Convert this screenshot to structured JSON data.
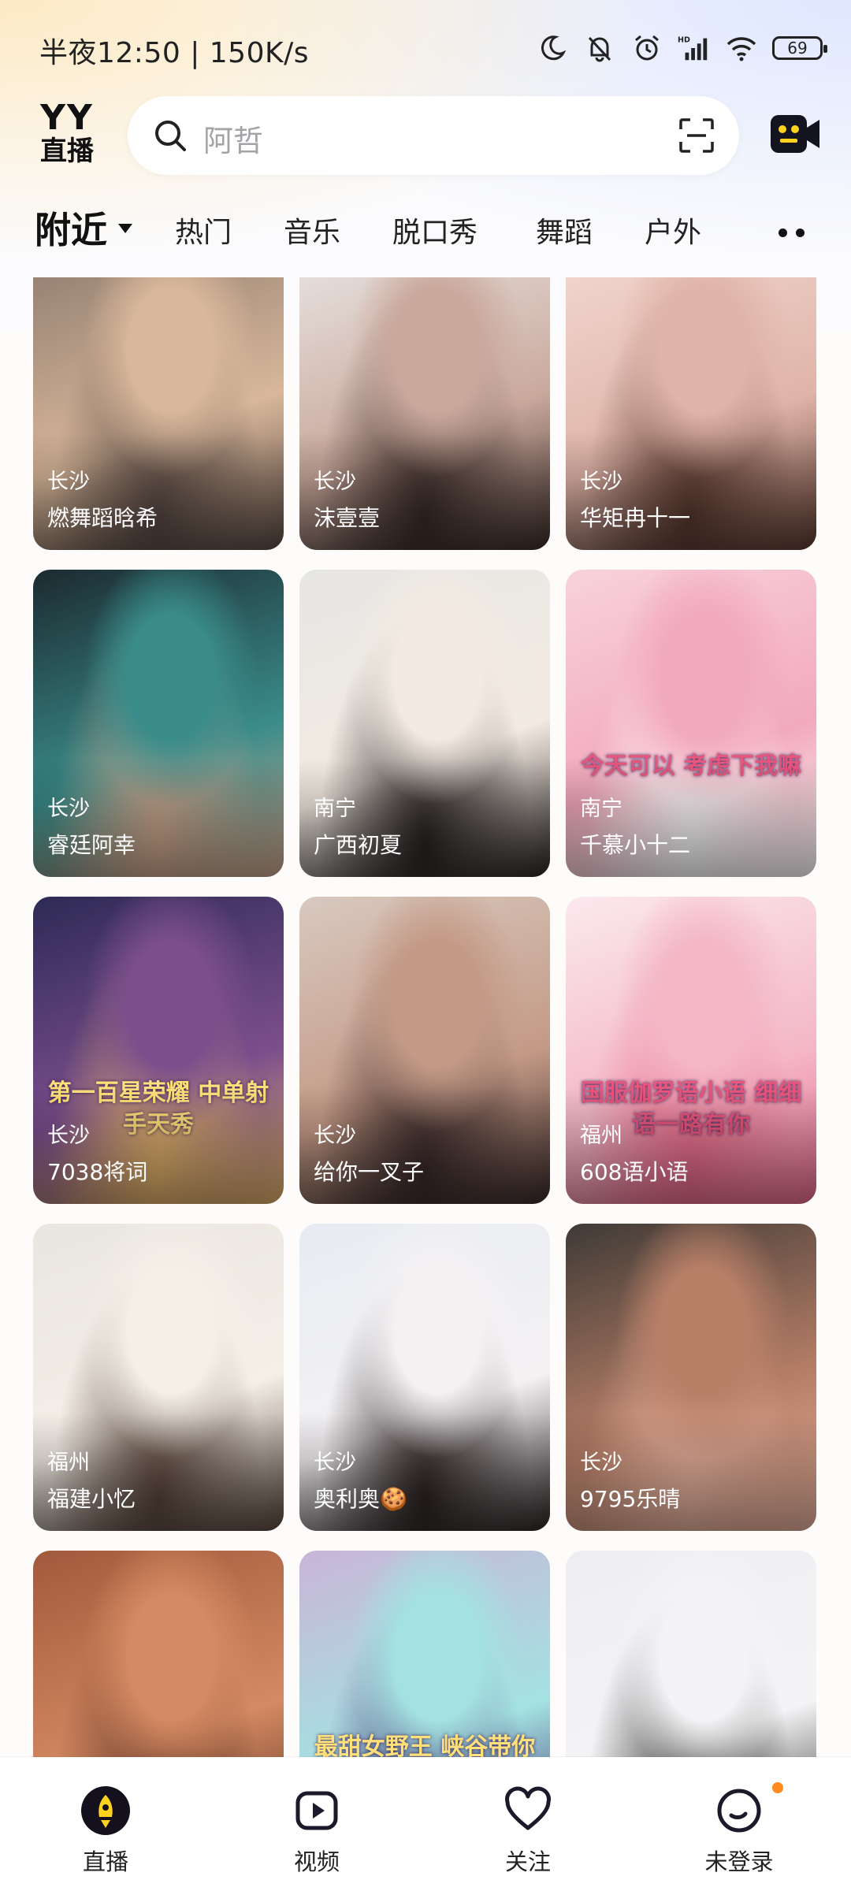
{
  "status_bar": {
    "time": "半夜12:50 | 150K/s",
    "battery": "69",
    "icons": [
      "moon-icon",
      "bell-off-icon",
      "alarm-icon",
      "signal-icon",
      "wifi-icon",
      "battery-icon"
    ]
  },
  "header": {
    "logo_top": "YY",
    "logo_bottom": "直播",
    "search_placeholder": "阿哲",
    "icons": [
      "search-icon",
      "scan-icon",
      "camera-icon"
    ]
  },
  "tabs": [
    {
      "label": "附近",
      "active": true
    },
    {
      "label": "热门"
    },
    {
      "label": "音乐"
    },
    {
      "label": "脱口秀"
    },
    {
      "label": "舞蹈"
    },
    {
      "label": "户外"
    }
  ],
  "streams": [
    {
      "city": "长沙",
      "name": "燃舞蹈晗希",
      "palette": [
        "#8c7a6e",
        "#d8b79a",
        "#5a4a44"
      ]
    },
    {
      "city": "长沙",
      "name": "沫壹壹",
      "palette": [
        "#e9e6e4",
        "#caa99d",
        "#3b2c28"
      ]
    },
    {
      "city": "长沙",
      "name": "华矩冉十一",
      "palette": [
        "#f2d9d3",
        "#e0b4a8",
        "#5b3a30"
      ]
    },
    {
      "city": "长沙",
      "name": "睿廷阿幸",
      "palette": [
        "#1c2a30",
        "#3a8c8a",
        "#d2a88e"
      ]
    },
    {
      "city": "南宁",
      "name": "广西初夏",
      "palette": [
        "#e6e6e4",
        "#f3ebe2",
        "#2a2424"
      ]
    },
    {
      "city": "南宁",
      "name": "千慕小十二",
      "palette": [
        "#f8d2dc",
        "#f2a9bd",
        "#ffffff"
      ],
      "overlay": "今天可以 考虑下我嘛"
    },
    {
      "city": "长沙",
      "name": "7038将词",
      "palette": [
        "#2d2a56",
        "#7b4e8c",
        "#e3b36a"
      ],
      "overlay": "第一百星荣耀 中单射手天秀"
    },
    {
      "city": "长沙",
      "name": "给你一叉子",
      "palette": [
        "#d8c9c0",
        "#c49a86",
        "#3a2a2a"
      ]
    },
    {
      "city": "福州",
      "name": "608语小语",
      "palette": [
        "#fbe9ee",
        "#f4b7c6",
        "#e86b8b"
      ],
      "overlay": "国服伽罗语小语 细细语一路有你"
    },
    {
      "city": "福州",
      "name": "福建小忆",
      "palette": [
        "#e9e5e0",
        "#f4efe7",
        "#5a463c"
      ]
    },
    {
      "city": "长沙",
      "name": "奥利奥🍪",
      "palette": [
        "#e7ecf2",
        "#f4f1f3",
        "#2d2424"
      ]
    },
    {
      "city": "长沙",
      "name": "9795乐晴",
      "palette": [
        "#3f3a36",
        "#b87f67",
        "#e9b39f"
      ]
    },
    {
      "city": "",
      "name": "",
      "palette": [
        "#a05a3c",
        "#d48a62",
        "#5a2f22"
      ]
    },
    {
      "city": "",
      "name": "",
      "palette": [
        "#c9b5d8",
        "#a4e2e2",
        "#3d2b6a"
      ],
      "overlay": "最甜女野王 峡谷带你"
    },
    {
      "city": "",
      "name": "",
      "palette": [
        "#eeeef2",
        "#f4f4f6",
        "#222222"
      ]
    }
  ],
  "bottom_nav": [
    {
      "label": "直播",
      "icon": "live-rocket-icon",
      "active": true
    },
    {
      "label": "视频",
      "icon": "video-icon"
    },
    {
      "label": "关注",
      "icon": "heart-icon"
    },
    {
      "label": "未登录",
      "icon": "profile-icon"
    }
  ]
}
